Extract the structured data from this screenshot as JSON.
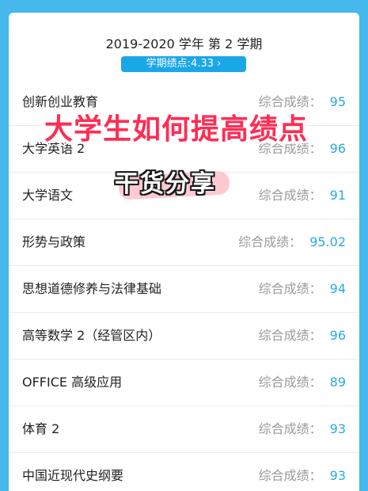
{
  "header": {
    "term_title": "2019-2020 学年 第 2 学期",
    "gpa_label": "学期绩点:4.33 ›"
  },
  "score_label": "综合成绩：",
  "courses": [
    {
      "name": "创新创业教育",
      "score": "95"
    },
    {
      "name": "大学英语 2",
      "score": "96"
    },
    {
      "name": "大学语文",
      "score": "91"
    },
    {
      "name": "形势与政策",
      "score": "95.02"
    },
    {
      "name": "思想道德修养与法律基础",
      "score": "94"
    },
    {
      "name": "高等数学 2（经管区内）",
      "score": "96"
    },
    {
      "name": "OFFICE 高级应用",
      "score": "89"
    },
    {
      "name": "体育 2",
      "score": "93"
    },
    {
      "name": "中国近现代史纲要",
      "score": "93"
    }
  ],
  "overlay": {
    "title": "大学生如何提高绩点",
    "subtitle": "干货分享"
  },
  "colors": {
    "background": "#45b8ec",
    "accent": "#1aa7e8",
    "score": "#2aa9e0",
    "overlay_title": "#ff2d54"
  }
}
